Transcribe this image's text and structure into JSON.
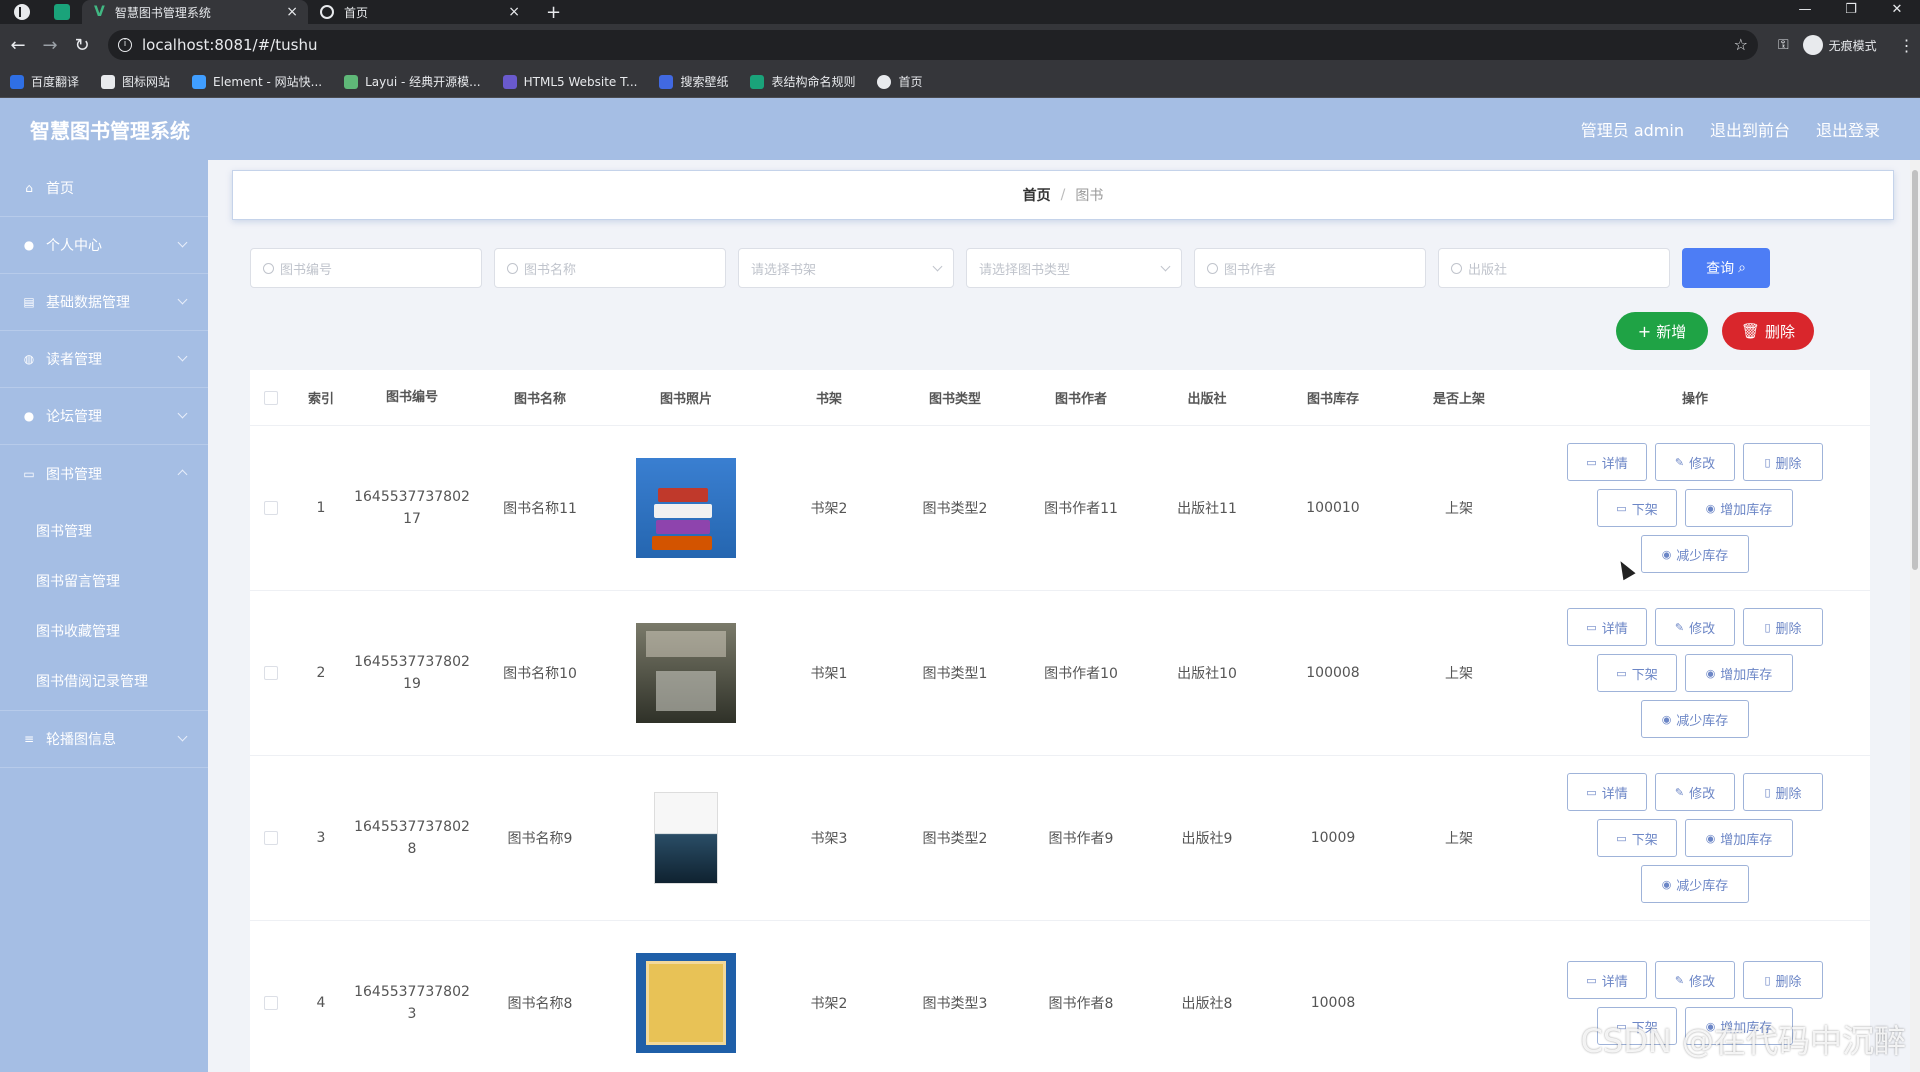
{
  "browser": {
    "tabs": [
      {
        "title": "智慧图书管理系统",
        "active": true
      },
      {
        "title": "首页",
        "active": false
      }
    ],
    "url": "localhost:8081/#/tushu",
    "profile_label": "无痕模式",
    "bookmarks": [
      {
        "label": "百度翻译",
        "color": "#2f6fe4"
      },
      {
        "label": "图标网站",
        "color": "#e8eaed"
      },
      {
        "label": "Element - 网站快...",
        "color": "#409eff"
      },
      {
        "label": "Layui - 经典开源模...",
        "color": "#5fb878"
      },
      {
        "label": "HTML5 Website T...",
        "color": "#6a5acd"
      },
      {
        "label": "搜索壁纸",
        "color": "#4169e1"
      },
      {
        "label": "表结构命名规则",
        "color": "#1aa37a"
      },
      {
        "label": "首页",
        "color": "#e8eaed"
      }
    ]
  },
  "header": {
    "title": "智慧图书管理系统",
    "admin": "管理员 admin",
    "back_to_front": "退出到前台",
    "logout": "退出登录"
  },
  "sidebar": {
    "items": [
      {
        "label": "首页",
        "icon": "home-icon",
        "arrow": false
      },
      {
        "label": "个人中心",
        "icon": "user-icon",
        "arrow": true
      },
      {
        "label": "基础数据管理",
        "icon": "grid-icon",
        "arrow": true
      },
      {
        "label": "读者管理",
        "icon": "reader-icon",
        "arrow": true
      },
      {
        "label": "论坛管理",
        "icon": "forum-icon",
        "arrow": true
      },
      {
        "label": "图书管理",
        "icon": "book-icon",
        "arrow": true
      }
    ],
    "sub_items": [
      "图书管理",
      "图书留言管理",
      "图书收藏管理",
      "图书借阅记录管理"
    ],
    "last_item": {
      "label": "轮播图信息",
      "icon": "list-icon"
    }
  },
  "breadcrumb": {
    "home": "首页",
    "sep": "/",
    "current": "图书"
  },
  "search": {
    "book_no_placeholder": "图书编号",
    "book_name_placeholder": "图书名称",
    "shelf_placeholder": "请选择书架",
    "type_placeholder": "请选择图书类型",
    "author_placeholder": "图书作者",
    "publisher_placeholder": "出版社",
    "query_label": "查询"
  },
  "actions": {
    "add": "新增",
    "delete": "删除"
  },
  "table": {
    "columns": [
      "索引",
      "图书编号",
      "图书名称",
      "图书照片",
      "书架",
      "图书类型",
      "图书作者",
      "出版社",
      "图书库存",
      "是否上架",
      "操作"
    ],
    "op_labels": {
      "detail": "详情",
      "edit": "修改",
      "delete": "删除",
      "off_shelf": "下架",
      "add_stock": "增加库存",
      "reduce_stock": "减少库存"
    },
    "rows": [
      {
        "idx": "1",
        "no": "164553773780217",
        "name": "图书名称11",
        "shelf": "书架2",
        "type": "图书类型2",
        "author": "图书作者11",
        "publisher": "出版社11",
        "stock": "100010",
        "status": "上架"
      },
      {
        "idx": "2",
        "no": "164553773780219",
        "name": "图书名称10",
        "shelf": "书架1",
        "type": "图书类型1",
        "author": "图书作者10",
        "publisher": "出版社10",
        "stock": "100008",
        "status": "上架"
      },
      {
        "idx": "3",
        "no": "16455377378028",
        "name": "图书名称9",
        "shelf": "书架3",
        "type": "图书类型2",
        "author": "图书作者9",
        "publisher": "出版社9",
        "stock": "10009",
        "status": "上架"
      },
      {
        "idx": "4",
        "no": "16455377378023",
        "name": "图书名称8",
        "shelf": "书架2",
        "type": "图书类型3",
        "author": "图书作者8",
        "publisher": "出版社8",
        "stock": "10008",
        "status": ""
      }
    ]
  },
  "watermark": "CSDN @在代码中沉醉"
}
